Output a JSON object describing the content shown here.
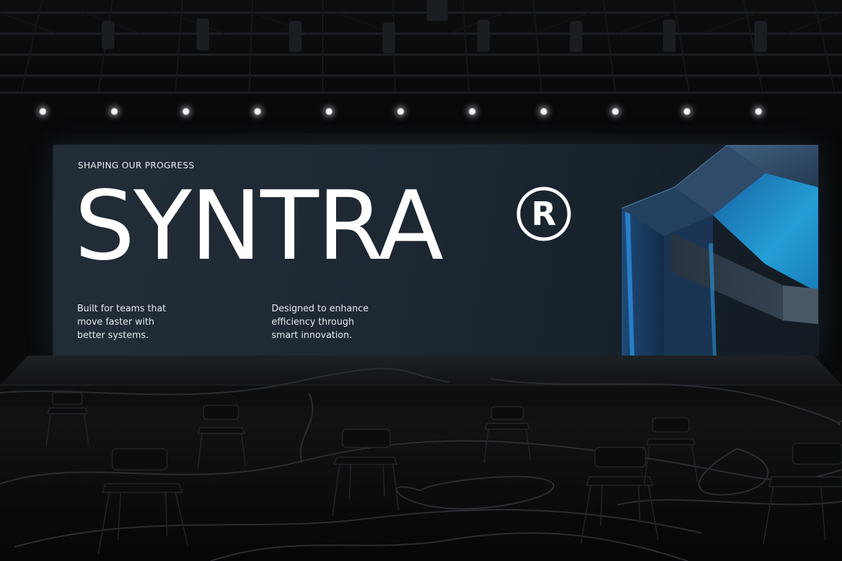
{
  "screen": {
    "eyebrow": "SHAPING OUR PROGRESS",
    "brand": "SYNTRA",
    "registered_mark": "®",
    "left_copy": [
      "Built for teams that",
      "move faster with",
      "better systems."
    ],
    "right_copy": [
      "Designed to enhance",
      "efficiency through",
      "smart innovation."
    ]
  },
  "colors": {
    "screen_bg": "#1f2a34",
    "text": "#ffffff",
    "accent_blue": "#1f9fe8"
  }
}
